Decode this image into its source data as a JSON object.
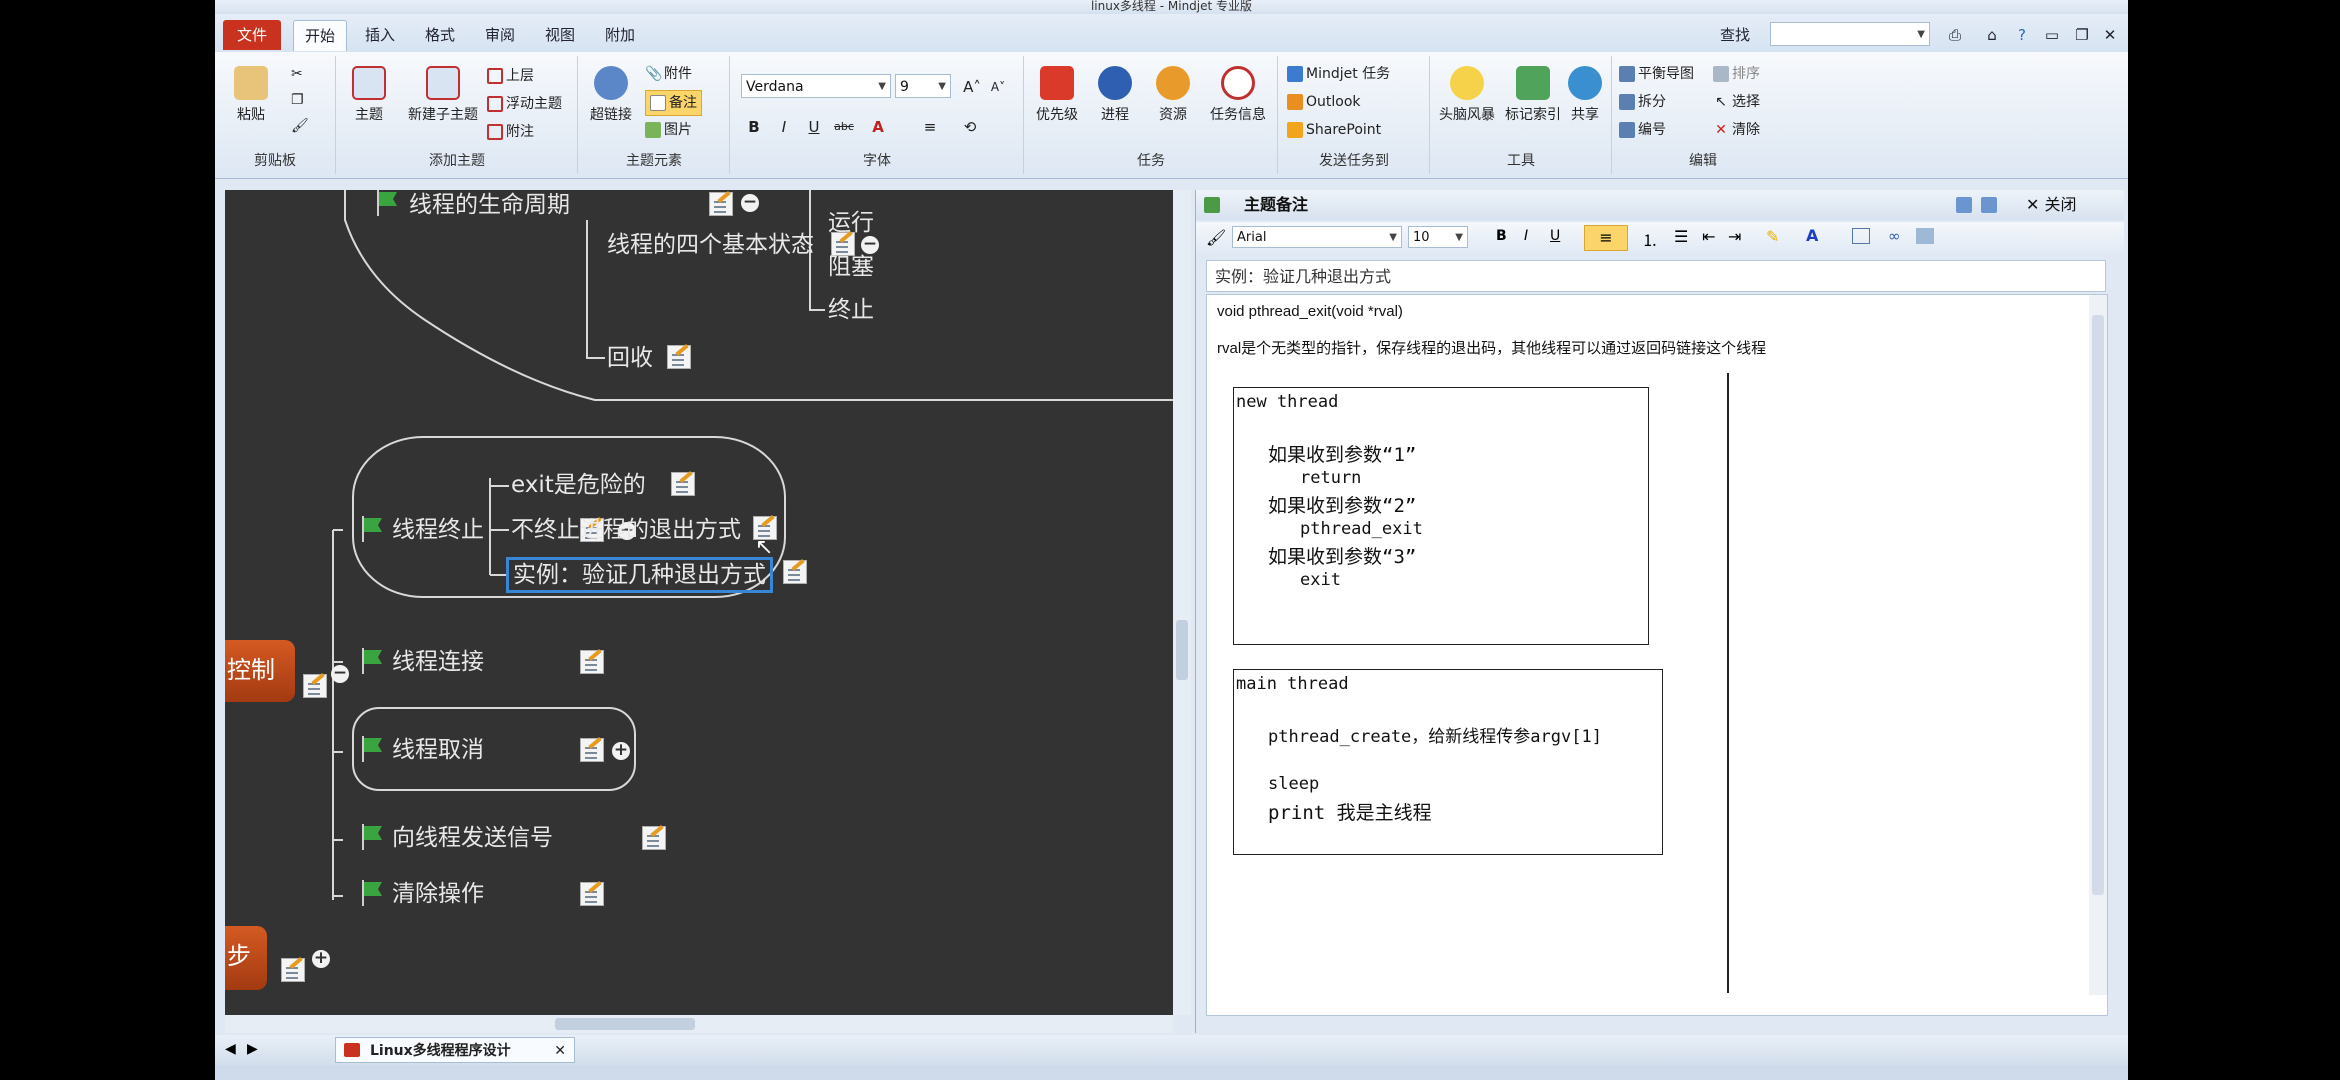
{
  "window": {
    "title": "linux多线程 - Mindjet 专业版"
  },
  "tabs": [
    "文件",
    "开始",
    "插入",
    "格式",
    "审阅",
    "视图",
    "附加"
  ],
  "search": {
    "label": "查找",
    "value": ""
  },
  "ribbon": {
    "clipboard": {
      "paste": "粘贴",
      "label": "剪贴板"
    },
    "add_topic": {
      "topic": "主题",
      "subtopic": "新建子主题",
      "top": "上层",
      "floating": "浮动主题",
      "callout": "附注",
      "label": "添加主题"
    },
    "elements": {
      "hyperlink": "超链接",
      "attachment": "附件",
      "notes": "备注",
      "picture": "图片",
      "label": "主题元素"
    },
    "font": {
      "name": "Verdana",
      "size": "9",
      "bold": "B",
      "italic": "I",
      "underline": "U",
      "strike": "abc",
      "label": "字体"
    },
    "task": {
      "priority": "优先级",
      "progress": "进程",
      "resource": "资源",
      "task_info": "任务信息",
      "label": "任务"
    },
    "send": {
      "mindjet": "Mindjet 任务",
      "outlook": "Outlook",
      "sharepoint": "SharePoint",
      "label": "发送任务到"
    },
    "tools": {
      "brainstorm": "头脑风暴",
      "index": "标记索引",
      "share": "共享",
      "label": "工具"
    },
    "edit": {
      "balance": "平衡导图",
      "sort": "排序",
      "split": "拆分",
      "select": "选择",
      "number": "编号",
      "clear": "清除",
      "label": "编辑"
    }
  },
  "map": {
    "lifecycle": "线程的生命周期",
    "four_states": "线程的四个基本状态",
    "states": [
      "运行",
      "阻塞",
      "终止"
    ],
    "reclaim": "回收",
    "control": "控制",
    "termination": "线程终止",
    "term_children": [
      "exit是危险的",
      "不终止进程的退出方式",
      "实例：验证几种退出方式"
    ],
    "join": "线程连接",
    "cancel": "线程取消",
    "signal": "向线程发送信号",
    "cleanup": "清除操作",
    "sync_partial": "步"
  },
  "notes": {
    "header": "主题备注",
    "close": "关闭",
    "font": "Arial",
    "size": "10",
    "title": "实例：验证几种退出方式",
    "line1": "void pthread_exit(void *rval)",
    "line2": "rval是个无类型的指针，保存线程的退出码，其他线程可以通过返回码链接这个线程",
    "box1": [
      "new thread",
      "如果收到参数“1”",
      "return",
      "如果收到参数“2”",
      "pthread_exit",
      "如果收到参数“3”",
      "exit"
    ],
    "box2": [
      "main thread",
      "pthread_create，给新线程传参argv[1]",
      "sleep",
      "print 我是主线程"
    ]
  },
  "document_tab": "Linux多线程程序设计"
}
